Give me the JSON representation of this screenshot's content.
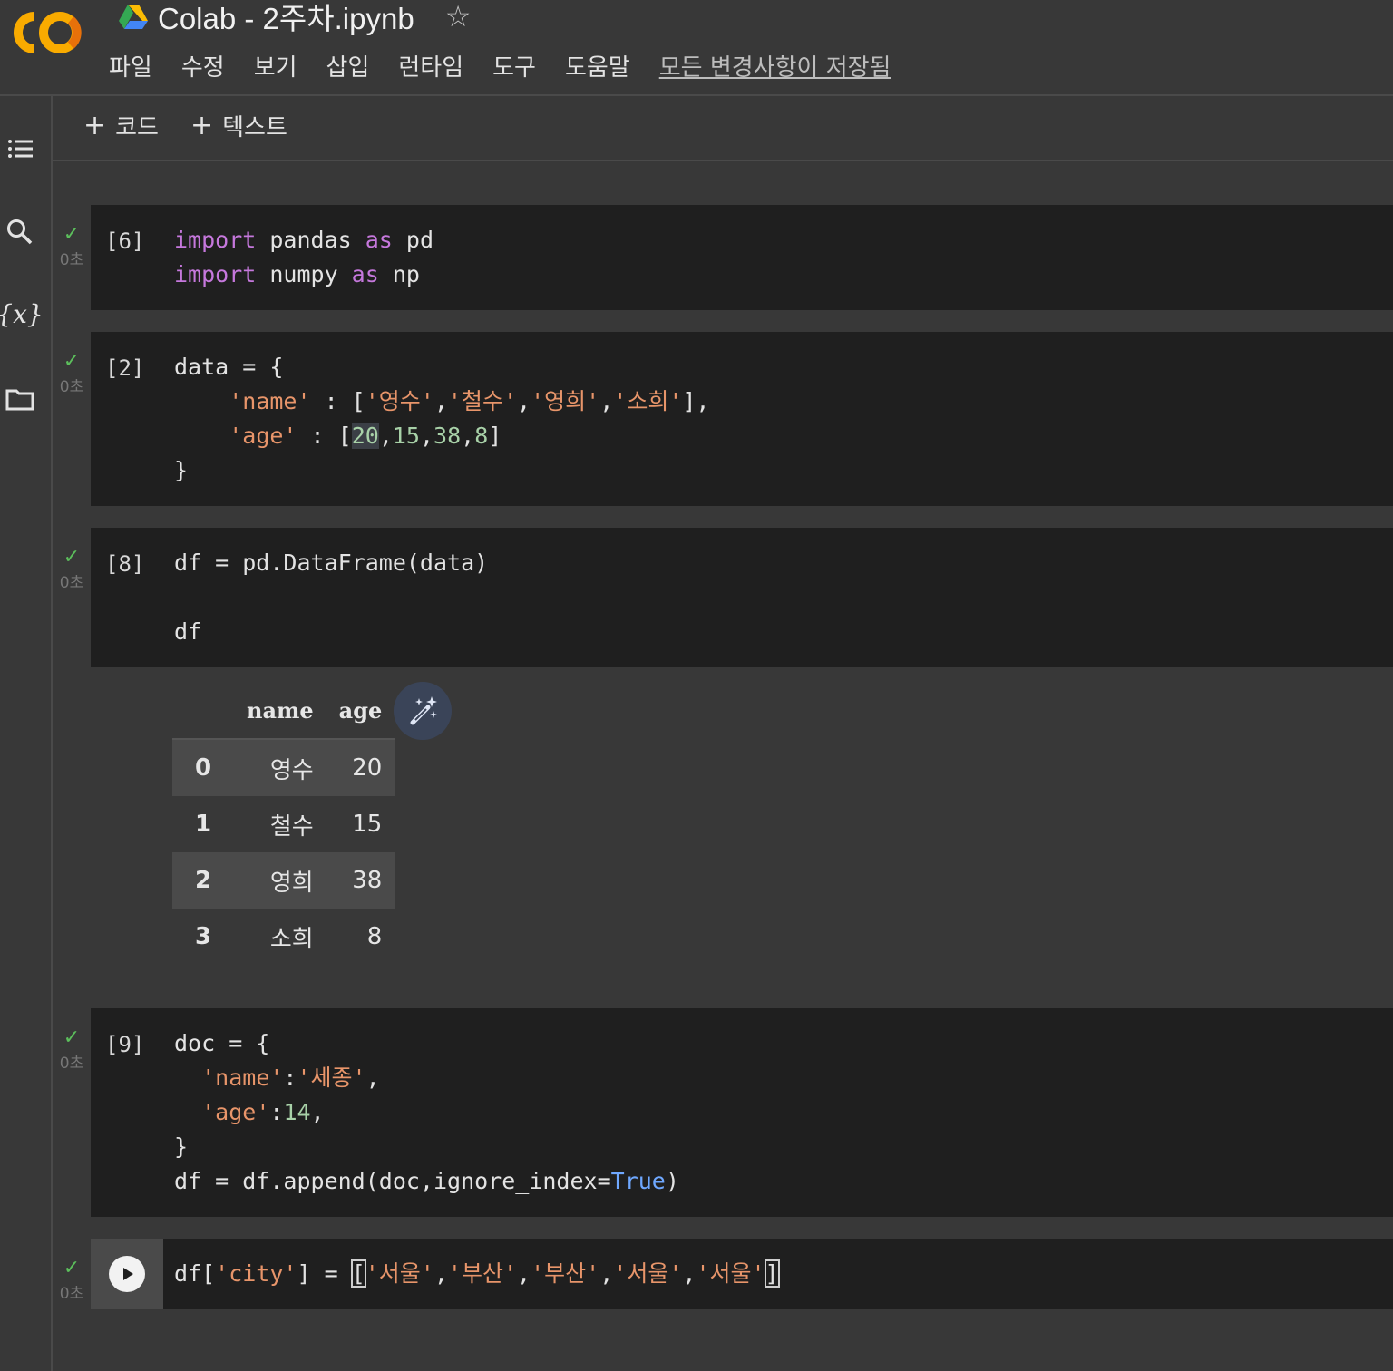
{
  "header": {
    "title": "Colab - 2주차.ipynb",
    "menu": [
      "파일",
      "수정",
      "보기",
      "삽입",
      "런타임",
      "도구",
      "도움말"
    ],
    "save_status": "모든 변경사항이 저장됨"
  },
  "toolbar": {
    "add_code": "코드",
    "add_text": "텍스트"
  },
  "rail": {
    "variables_label": "{x}"
  },
  "cells": [
    {
      "exec": "[6]",
      "duration": "0초"
    },
    {
      "exec": "[2]",
      "duration": "0초"
    },
    {
      "exec": "[8]",
      "duration": "0초"
    },
    {
      "exec": "[9]",
      "duration": "0초"
    },
    {
      "exec": "",
      "duration": "0초"
    }
  ],
  "code": {
    "c1_l1_kw1": "import",
    "c1_l1_mod": " pandas ",
    "c1_l1_kw2": "as",
    "c1_l1_alias": " pd",
    "c1_l2_kw1": "import",
    "c1_l2_mod": " numpy ",
    "c1_l2_kw2": "as",
    "c1_l2_alias": " np",
    "c2_l1": "data = {",
    "c2_l2_key": "'name'",
    "c2_l2_mid": " : [",
    "c2_l2_v1": "'영수'",
    "c2_l2_v2": "'철수'",
    "c2_l2_v3": "'영희'",
    "c2_l2_v4": "'소희'",
    "c2_l2_end": "],",
    "c2_l3_key": "'age'",
    "c2_l3_mid": " : [",
    "c2_l3_n1": "20",
    "c2_l3_n2": "15",
    "c2_l3_n3": "38",
    "c2_l3_n4": "8",
    "c2_l3_end": "]",
    "c2_l4": "}",
    "c3_l1": "df = pd.DataFrame(data)",
    "c3_l2": "df",
    "c4_l1": "doc = {",
    "c4_l2_key": "'name'",
    "c4_l2_val": "'세종'",
    "c4_l3_key": "'age'",
    "c4_l3_val": "14",
    "c4_l4": "}",
    "c4_l5_a": "df = df.append(doc,ignore_index=",
    "c4_l5_const": "True",
    "c4_l5_b": ")",
    "c5_a": "df[",
    "c5_key": "'city'",
    "c5_b": "] = ",
    "c5_v1": "'서울'",
    "c5_v2": "'부산'",
    "c5_v3": "'부산'",
    "c5_v4": "'서울'",
    "c5_v5": "'서울'"
  },
  "output_table": {
    "columns": [
      "name",
      "age"
    ],
    "rows": [
      [
        "0",
        "영수",
        "20"
      ],
      [
        "1",
        "철수",
        "15"
      ],
      [
        "2",
        "영희",
        "38"
      ],
      [
        "3",
        "소희",
        "8"
      ]
    ]
  },
  "colors": {
    "keyword": "#c678dd",
    "string": "#e8956a",
    "number": "#a8d1a8",
    "constant": "#6fa8ff",
    "success": "#5cbf5c"
  }
}
